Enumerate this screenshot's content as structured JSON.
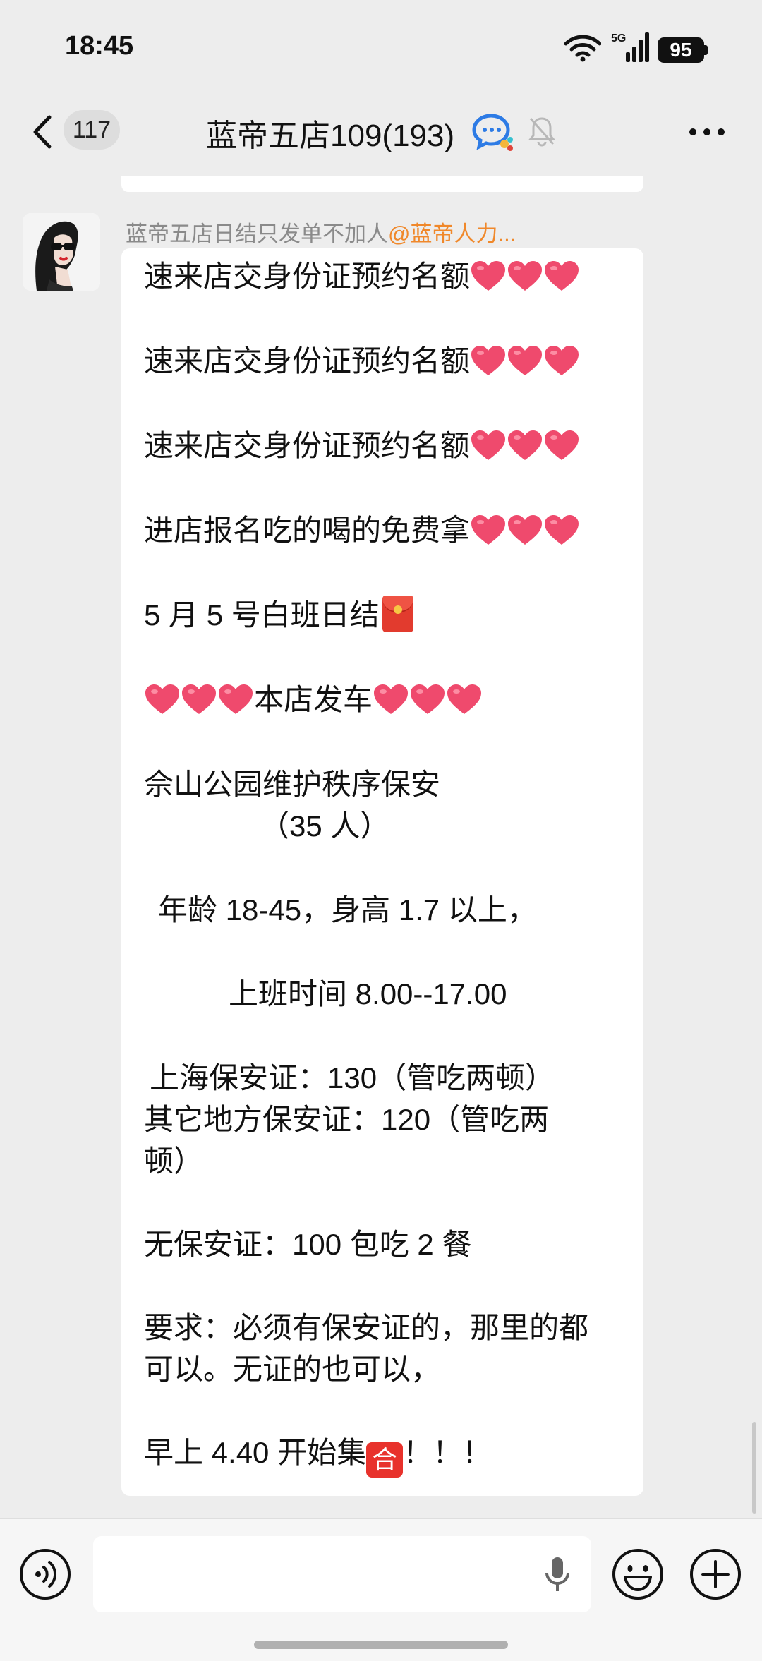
{
  "status_bar": {
    "time": "18:45",
    "network": "5G",
    "battery": "95"
  },
  "header": {
    "back_count": "117",
    "title": "蓝帝五店109(193)"
  },
  "message": {
    "sender": "蓝帝五店日结只发单不加人",
    "mention": "@蓝帝人力...",
    "lines": [
      "速来店交身份证预约名额",
      "速来店交身份证预约名额",
      "速来店交身份证预约名额",
      "进店报名吃的喝的免费拿",
      "5 月 5 号白班日结",
      "本店发车",
      "佘山公园维护秩序保安",
      "（35 人）",
      "年龄 18-45，身高 1.7 以上，",
      "上班时间 8.00--17.00",
      "上海保安证：130（管吃两顿）",
      "其它地方保安证：120（管吃两",
      "顿）",
      "无保安证：100 包吃 2 餐",
      "要求：必须有保安证的，那里的都",
      "可以。无证的也可以，",
      "早上 4.40 开始集",
      "合",
      "！！！"
    ]
  },
  "icons": {
    "back": "chevron-left-icon",
    "group_type": "chat-bubble-icon",
    "mute": "bell-off-icon",
    "more": "more-dots-icon",
    "voice": "voice-icon",
    "mic": "microphone-icon",
    "emoji": "emoji-icon",
    "plus": "plus-icon",
    "heart": "heart-emoji",
    "red_packet": "red-packet-emoji"
  },
  "colors": {
    "mention": "#f0882a",
    "heart": "#ef4a6d",
    "red_box": "#e8322c"
  }
}
